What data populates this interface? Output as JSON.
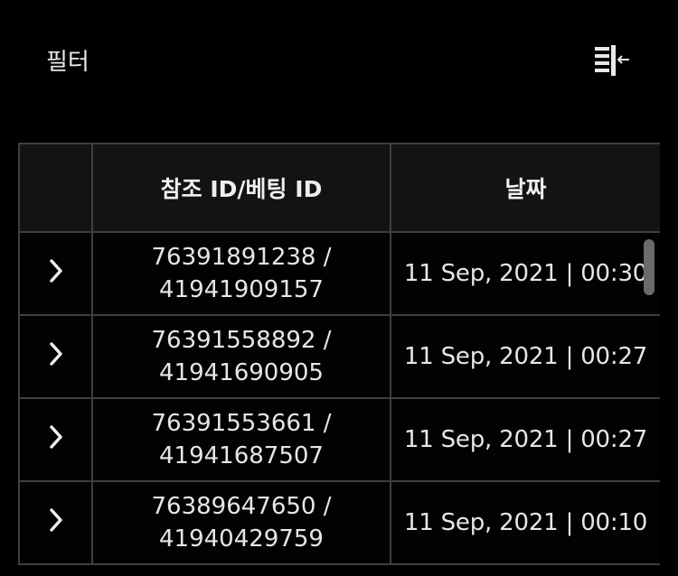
{
  "toolbar": {
    "filter_label": "필터",
    "collapse_icon": "collapse-columns-icon"
  },
  "table": {
    "headers": {
      "expand": "",
      "ref_bet_id": "참조 ID/베팅 ID",
      "date": "날짜"
    },
    "rows": [
      {
        "ref_id": "76391891238 /",
        "bet_id": "41941909157",
        "date": "11 Sep, 2021 | 00:30"
      },
      {
        "ref_id": "76391558892 /",
        "bet_id": "41941690905",
        "date": "11 Sep, 2021 | 00:27"
      },
      {
        "ref_id": "76391553661 /",
        "bet_id": "41941687507",
        "date": "11 Sep, 2021 | 00:27"
      },
      {
        "ref_id": "76389647650 /",
        "bet_id": "41940429759",
        "date": "11 Sep, 2021 | 00:10"
      }
    ]
  },
  "colors": {
    "background": "#000000",
    "header_bg": "#131313",
    "border": "#3f3f3f",
    "text": "#e6e6e6",
    "scrollbar": "#6b6b6b"
  }
}
